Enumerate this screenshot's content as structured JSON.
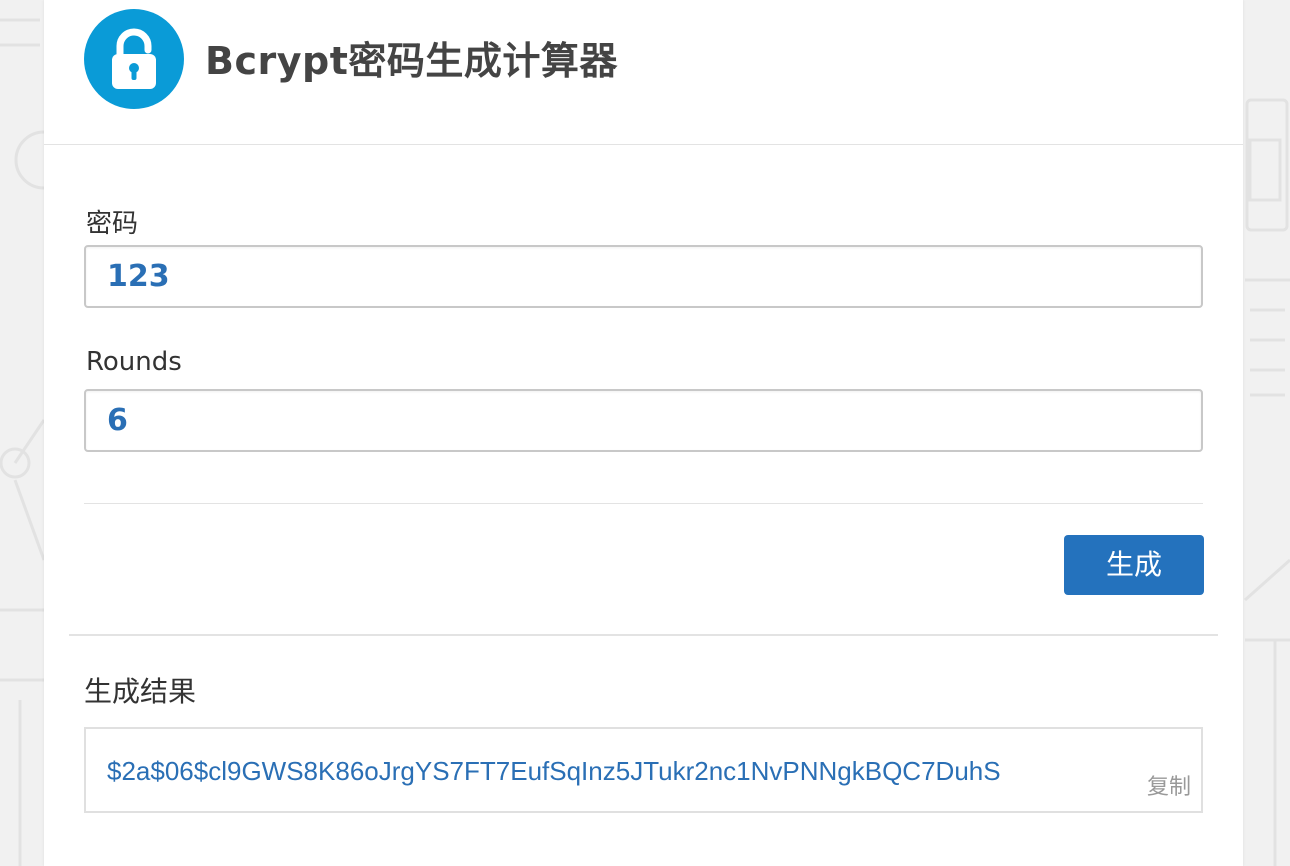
{
  "header": {
    "title": "Bcrypt密码生成计算器",
    "logo_icon": "padlock-icon",
    "logo_color": "#0a9bd7"
  },
  "form": {
    "password_label": "密码",
    "password_value": "123",
    "rounds_label": "Rounds",
    "rounds_value": "6",
    "generate_label": "生成"
  },
  "result": {
    "label": "生成结果",
    "value": "$2a$06$cl9GWS8K86oJrgYS7FT7EufSqInz5JTukr2nc1NvPNNgkBQC7DuhS",
    "copy_label": "复制"
  },
  "colors": {
    "accent": "#2472bd",
    "value_text": "#2a6fb5",
    "background": "#f1f1f1"
  }
}
